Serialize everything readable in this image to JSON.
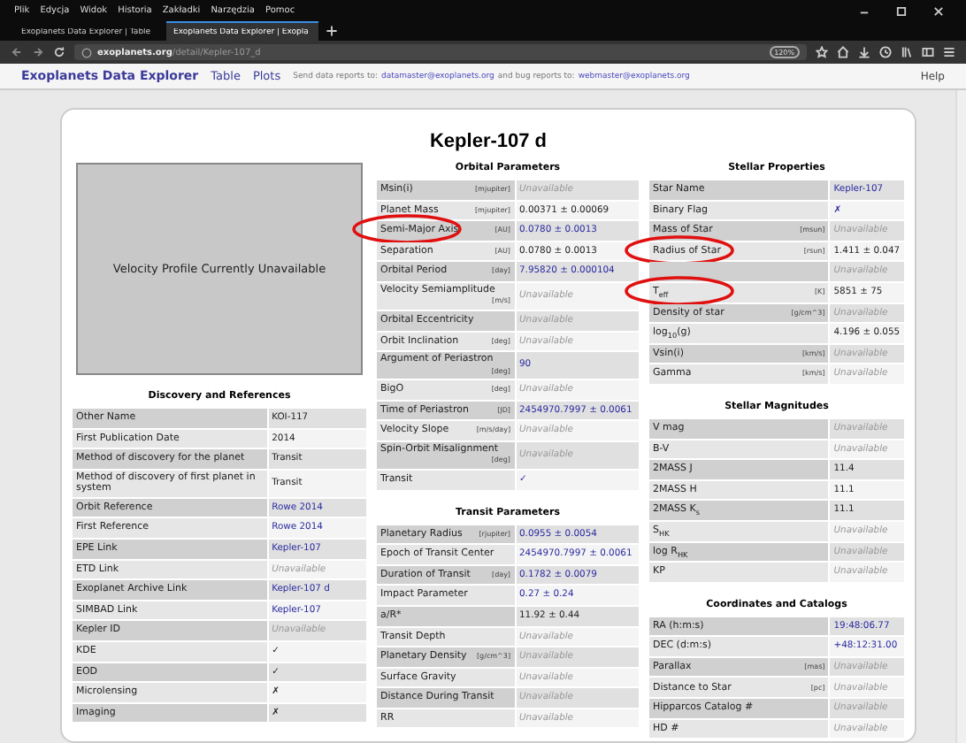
{
  "browser": {
    "menu": [
      "Plik",
      "Edycja",
      "Widok",
      "Historia",
      "Zakładki",
      "Narzędzia",
      "Pomoc"
    ],
    "tabs": [
      {
        "label": "Exoplanets Data Explorer | Table",
        "selected": false
      },
      {
        "label": "Exoplanets Data Explorer | Exopla",
        "selected": true
      }
    ],
    "url": {
      "domain": "exoplanets.org",
      "path": "/detail/Kepler-107_d"
    },
    "zoom": "120%"
  },
  "navbar": {
    "brand": "Exoplanets Data Explorer",
    "links": [
      "Table",
      "Plots"
    ],
    "note_1": "Send data reports to:",
    "email_1": "datamaster@exoplanets.org",
    "note_2": "and bug reports to:",
    "email_2": "webmaster@exoplanets.org",
    "help": "Help"
  },
  "title": "Kepler-107 d",
  "velocity_placeholder": "Velocity Profile Currently Unavailable",
  "left_sections": [
    {
      "title": "Discovery and References",
      "rows": [
        {
          "label": "Other Name",
          "value": "KOI-117",
          "kind": "plain"
        },
        {
          "label": "First Publication Date",
          "value": "2014",
          "kind": "plain"
        },
        {
          "label": "Method of discovery for the planet",
          "value": "Transit",
          "kind": "plain"
        },
        {
          "label": "Method of discovery of first planet in system",
          "value": "Transit",
          "kind": "plain"
        },
        {
          "label": "Orbit Reference",
          "value": "Rowe 2014",
          "kind": "link"
        },
        {
          "label": "First Reference",
          "value": "Rowe 2014",
          "kind": "link"
        },
        {
          "label": "EPE Link",
          "value": "Kepler-107",
          "kind": "link"
        },
        {
          "label": "ETD Link",
          "value": "Unavailable",
          "kind": "unavailable"
        },
        {
          "label": "Exoplanet Archive Link",
          "value": "Kepler-107 d",
          "kind": "link"
        },
        {
          "label": "SIMBAD Link",
          "value": "Kepler-107",
          "kind": "link"
        },
        {
          "label": "Kepler ID",
          "value": "Unavailable",
          "kind": "unavailable"
        },
        {
          "label": "KDE",
          "value": "✓",
          "kind": "plain"
        },
        {
          "label": "EOD",
          "value": "✓",
          "kind": "plain"
        },
        {
          "label": "Microlensing",
          "value": "✗",
          "kind": "plain"
        },
        {
          "label": "Imaging",
          "value": "✗",
          "kind": "plain"
        }
      ]
    }
  ],
  "middle_sections": [
    {
      "title": "Orbital Parameters",
      "rows": [
        {
          "label": "Msin(i)",
          "unit": "[mjupiter]",
          "value": "Unavailable",
          "kind": "unavailable"
        },
        {
          "label": "Planet Mass",
          "unit": "[mjupiter]",
          "value": "0.00371 ± 0.00069",
          "kind": "plain"
        },
        {
          "label": "Semi-Major Axis",
          "unit": "[AU]",
          "value": "0.0780 ± 0.0013",
          "kind": "link",
          "circled": true
        },
        {
          "label": "Separation",
          "unit": "[AU]",
          "value": "0.0780 ± 0.0013",
          "kind": "plain"
        },
        {
          "label": "Orbital Period",
          "unit": "[day]",
          "value": "7.95820 ± 0.000104",
          "kind": "link"
        },
        {
          "label": "Velocity Semiamplitude",
          "unit": "[m/s]",
          "value": "Unavailable",
          "kind": "unavailable"
        },
        {
          "label": "Orbital Eccentricity",
          "value": "Unavailable",
          "kind": "unavailable"
        },
        {
          "label": "Orbit Inclination",
          "unit": "[deg]",
          "value": "Unavailable",
          "kind": "unavailable"
        },
        {
          "label": "Argument of Periastron",
          "unit": "[deg]",
          "value": "90",
          "kind": "link"
        },
        {
          "label": "BigO",
          "unit": "[deg]",
          "value": "Unavailable",
          "kind": "unavailable"
        },
        {
          "label": "Time of Periastron",
          "unit": "[JD]",
          "value": "2454970.7997 ± 0.0061",
          "kind": "link"
        },
        {
          "label": "Velocity Slope",
          "unit": "[m/s/day]",
          "value": "Unavailable",
          "kind": "unavailable"
        },
        {
          "label": "Spin-Orbit Misalignment",
          "unit": "[deg]",
          "value": "Unavailable",
          "kind": "unavailable"
        },
        {
          "label": "Transit",
          "value": "✓",
          "kind": "link"
        }
      ]
    },
    {
      "title": "Transit Parameters",
      "rows": [
        {
          "label": "Planetary Radius",
          "unit": "[rjupiter]",
          "value": "0.0955 ± 0.0054",
          "kind": "link"
        },
        {
          "label": "Epoch of Transit Center",
          "value": "2454970.7997 ± 0.0061",
          "kind": "link"
        },
        {
          "label": "Duration of Transit",
          "unit": "[day]",
          "value": "0.1782 ± 0.0079",
          "kind": "link"
        },
        {
          "label": "Impact Parameter",
          "value": "0.27 ± 0.24",
          "kind": "link"
        },
        {
          "label": "a/R*",
          "value": "11.92 ± 0.44",
          "kind": "plain"
        },
        {
          "label": "Transit Depth",
          "value": "Unavailable",
          "kind": "unavailable"
        },
        {
          "label": "Planetary Density",
          "unit": "[g/cm^3]",
          "value": "Unavailable",
          "kind": "unavailable"
        },
        {
          "label": "Surface Gravity",
          "value": "Unavailable",
          "kind": "unavailable"
        },
        {
          "label": "Distance During Transit",
          "value": "Unavailable",
          "kind": "unavailable"
        },
        {
          "label": "RR",
          "value": "Unavailable",
          "kind": "unavailable"
        }
      ]
    }
  ],
  "right_sections": [
    {
      "title": "Stellar Properties",
      "rows": [
        {
          "label": "Star Name",
          "value": "Kepler-107",
          "kind": "link"
        },
        {
          "label": "Binary Flag",
          "value": "✗",
          "kind": "link"
        },
        {
          "label": "Mass of Star",
          "unit": "[msun]",
          "value": "Unavailable",
          "kind": "unavailable"
        },
        {
          "label": "Radius of Star",
          "unit": "[rsun]",
          "value": "1.411 ± 0.047",
          "kind": "plain",
          "circled": true
        },
        {
          "value": "Unavailable",
          "kind": "unavailable"
        },
        {
          "label": "T$_{eff}$",
          "unit": "[K]",
          "value": "5851 ± 75",
          "kind": "plain",
          "circled": true
        },
        {
          "label": "Density of star",
          "unit": "[g/cm^3]",
          "value": "Unavailable",
          "kind": "unavailable"
        },
        {
          "label": "log$_{10}$(g)",
          "value": "4.196 ± 0.055",
          "kind": "plain"
        },
        {
          "label": "Vsin(i)",
          "unit": "[km/s]",
          "value": "Unavailable",
          "kind": "unavailable"
        },
        {
          "label": "Gamma",
          "unit": "[km/s]",
          "value": "Unavailable",
          "kind": "unavailable"
        }
      ]
    },
    {
      "title": "Stellar Magnitudes",
      "rows": [
        {
          "label": "V mag",
          "value": "Unavailable",
          "kind": "unavailable"
        },
        {
          "label": "B-V",
          "value": "Unavailable",
          "kind": "unavailable"
        },
        {
          "label": "2MASS J",
          "value": "11.4",
          "kind": "plain"
        },
        {
          "label": "2MASS H",
          "value": "11.1",
          "kind": "plain"
        },
        {
          "label": "2MASS K$_{s}$",
          "value": "11.1",
          "kind": "plain"
        },
        {
          "label": "S$_{HK}$",
          "value": "Unavailable",
          "kind": "unavailable"
        },
        {
          "label": "log R$_{HK}$",
          "value": "Unavailable",
          "kind": "unavailable"
        },
        {
          "label": "KP",
          "value": "Unavailable",
          "kind": "unavailable"
        }
      ]
    },
    {
      "title": "Coordinates and Catalogs",
      "rows": [
        {
          "label": "RA (h:m:s)",
          "value": "19:48:06.77",
          "kind": "link"
        },
        {
          "label": "DEC (d:m:s)",
          "value": "+48:12:31.00",
          "kind": "link"
        },
        {
          "label": "Parallax",
          "unit": "[mas]",
          "value": "Unavailable",
          "kind": "unavailable"
        },
        {
          "label": "Distance to Star",
          "unit": "[pc]",
          "value": "Unavailable",
          "kind": "unavailable"
        },
        {
          "label": "Hipparcos Catalog #",
          "value": "Unavailable",
          "kind": "unavailable"
        },
        {
          "label": "HD #",
          "value": "Unavailable",
          "kind": "unavailable"
        }
      ]
    }
  ]
}
